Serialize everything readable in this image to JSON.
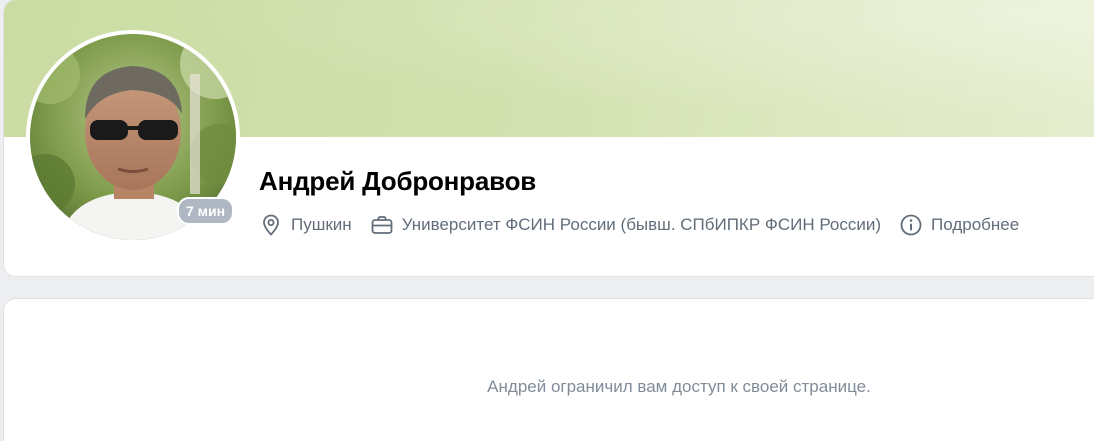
{
  "profile": {
    "name": "Андрей Добронравов",
    "online_badge": "7 мин",
    "avatar_icon": "user-photo",
    "cover_colors": [
      "#cbdca3",
      "#e6eecf"
    ]
  },
  "meta": {
    "city": {
      "icon": "location-pin-icon",
      "label": "Пушкин"
    },
    "education": {
      "icon": "briefcase-icon",
      "label": "Университет ФСИН России (бывш. СПбИПКР ФСИН России)"
    },
    "details": {
      "icon": "info-circle-icon",
      "label": "Подробнее"
    }
  },
  "content": {
    "restricted_message": "Андрей ограничил вам доступ к своей странице."
  },
  "colors": {
    "meta_text": "#626d7a",
    "muted_text": "#818c99",
    "badge_bg": "#aeb7c2",
    "page_bg": "#edeef0"
  }
}
